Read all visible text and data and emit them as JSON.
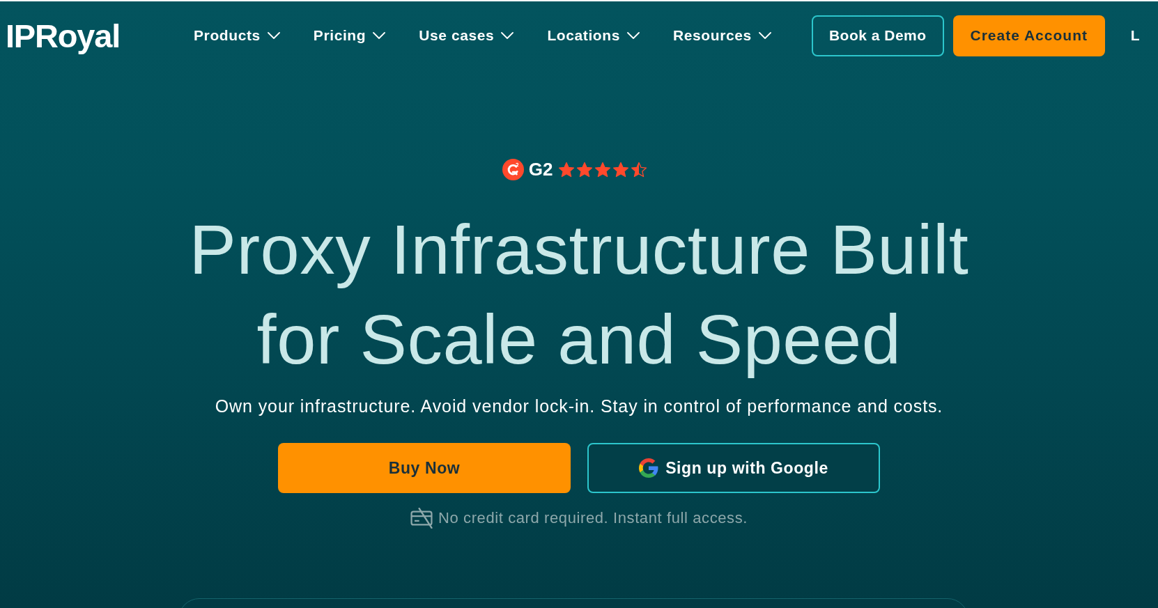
{
  "nav": {
    "logo": "IPRoyal",
    "menu": [
      "Products",
      "Pricing",
      "Use cases",
      "Locations",
      "Resources"
    ],
    "buttons": [
      {
        "label": "Book a Demo",
        "kind": "outline"
      },
      {
        "label": "Create Account",
        "kind": "primary"
      }
    ],
    "cut_link": "L"
  },
  "hero": {
    "rating": {
      "brand": "G2",
      "stars": 4.5
    },
    "title": "Proxy Infrastructure Built for Scale and Speed",
    "subtitle": "Own your infrastructure. Avoid vendor lock-in. Stay in control of performance and costs.",
    "actions": [
      {
        "label": "Buy Now",
        "kind": "primary"
      },
      {
        "label": "Sign up with Google",
        "kind": "google"
      }
    ],
    "note": "No credit card required. Instant full access."
  }
}
